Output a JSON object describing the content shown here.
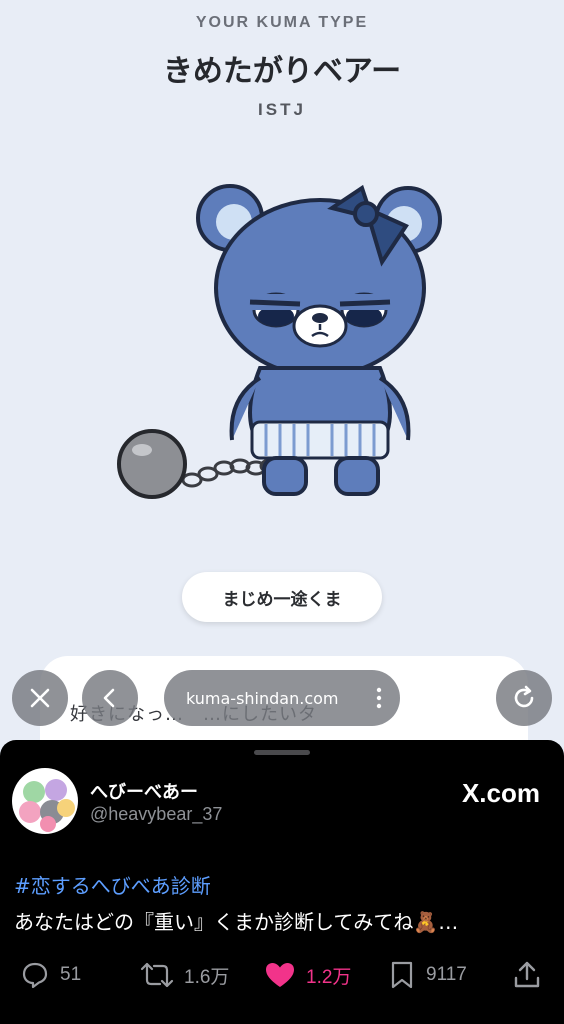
{
  "webpage": {
    "eyebrow": "YOUR KUMA TYPE",
    "title": "きめたがりベアー",
    "mbti": "ISTJ",
    "trait_pill": "まじめ一途くま",
    "description": "好きになっ…　…にしたいタ",
    "bear_colors": {
      "body": "#5e7dbb",
      "outline": "#1f2a44",
      "ear_inner": "#cfe0f4",
      "ball": "#8d8f94"
    }
  },
  "browser_bar": {
    "close_icon": "close-icon",
    "back_icon": "chevron-left-icon",
    "url": "kuma-shindan.com",
    "more_icon": "more-vertical-icon",
    "reload_icon": "reload-icon"
  },
  "tweet": {
    "display_name": "へびーべあー",
    "handle": "@heavybear_37",
    "source": "X.com",
    "hashtag": "#恋するへびべあ診断",
    "text": "あなたはどの『重い』くまか診断してみてね🧸…",
    "actions": {
      "replies": "51",
      "retweets": "1.6万",
      "likes": "1.2万",
      "bookmarks": "9117"
    },
    "accent_color": "#5d9eff",
    "like_color": "#f2338a"
  }
}
